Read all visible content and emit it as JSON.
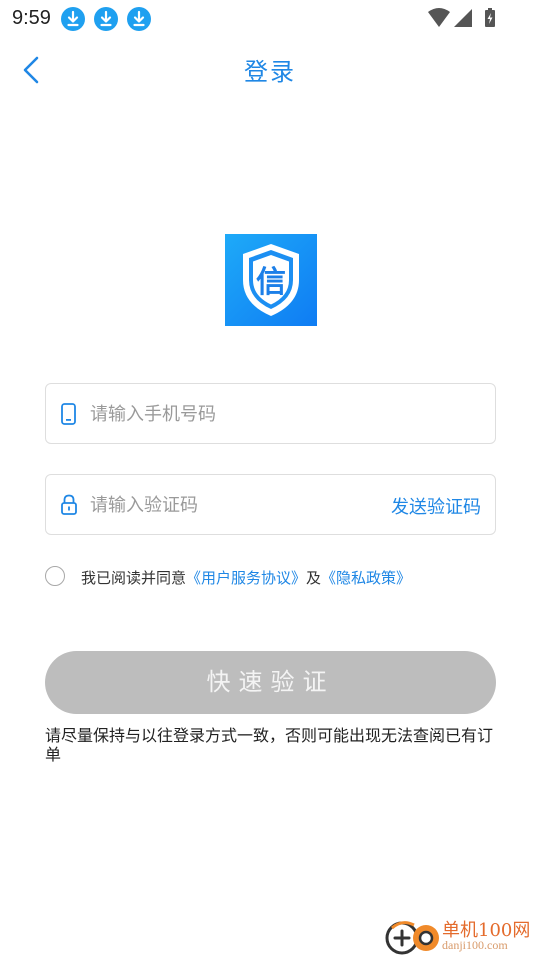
{
  "status_bar": {
    "time": "9:59",
    "download_icons": [
      "download-icon",
      "download-icon",
      "download-icon"
    ],
    "right_icons": [
      "wifi-icon",
      "signal-icon",
      "battery-icon"
    ]
  },
  "nav": {
    "back_icon": "chevron-left-icon",
    "title": "登录"
  },
  "logo": {
    "icon": "shield-icon",
    "glyph": "信",
    "color_start": "#1eaaf8",
    "color_end": "#0f7cf3"
  },
  "phone_field": {
    "icon": "phone-icon",
    "value": "",
    "placeholder": "请输入手机号码"
  },
  "code_field": {
    "icon": "lock-icon",
    "value": "",
    "placeholder": "请输入验证码",
    "send_label": "发送验证码"
  },
  "agreement": {
    "checked": false,
    "prefix": "我已阅读并同意",
    "user_agreement": "《用户服务协议》",
    "conjunction": "及",
    "privacy_policy": "《隐私政策》"
  },
  "verify_button": {
    "label": "快速验证",
    "color": "#bdbdbd"
  },
  "hint": {
    "text": "请尽量保持与以往登录方式一致，否则可能出现无法查阅已有订单"
  },
  "watermark": {
    "title": "单机100网",
    "subtitle": "danji100.com"
  },
  "colors": {
    "accent": "#1f87e5",
    "border": "#dedede"
  }
}
